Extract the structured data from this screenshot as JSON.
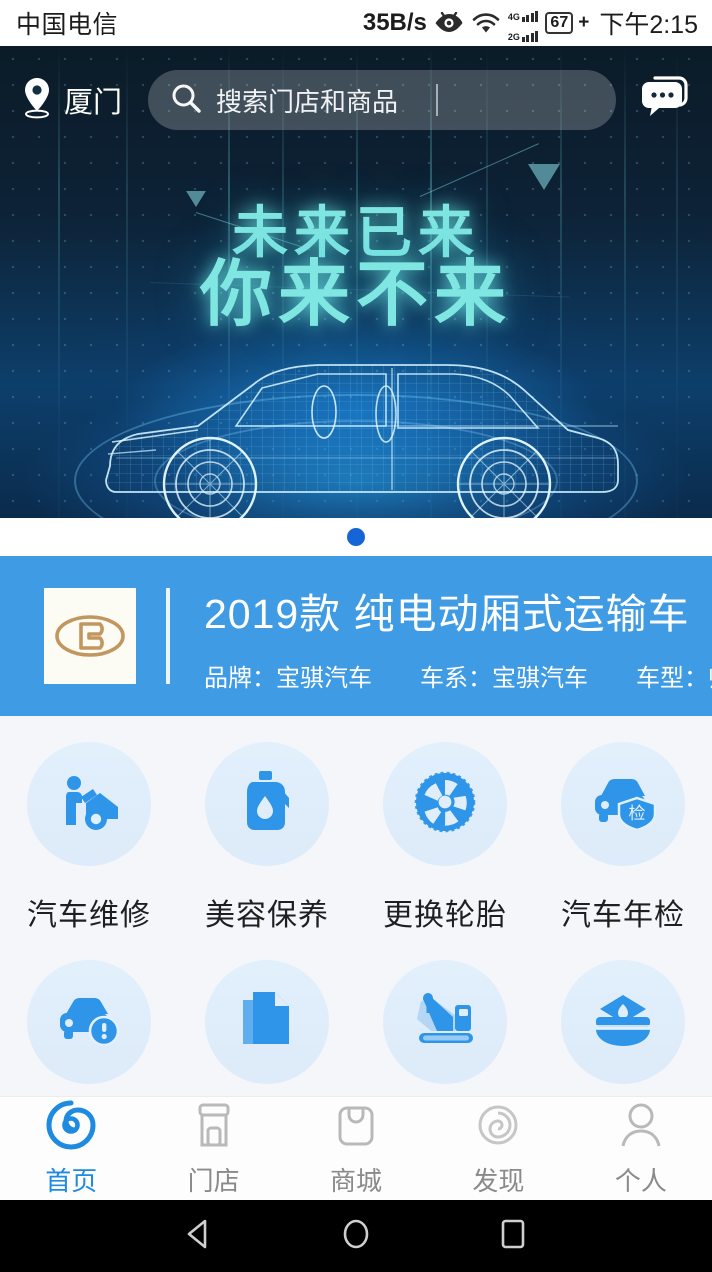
{
  "statusbar": {
    "carrier": "中国电信",
    "network_speed": "35B/s",
    "battery_percent": "67",
    "charging_glyph": "+",
    "time": "下午2:15",
    "signal_4g": "4G",
    "signal_2g": "2G",
    "icons": [
      "eye-icon",
      "wifi-icon",
      "signal-icon",
      "battery-icon"
    ]
  },
  "header": {
    "location": "厦门",
    "location_icon": "map-pin-icon",
    "search_placeholder": "搜索门店和商品",
    "search_value": "",
    "search_icon": "search-icon",
    "chat_icon": "chat-bubble-icon"
  },
  "hero": {
    "line1": "未来已来",
    "line2": "你来不来",
    "accent_color": "#7FE6E2",
    "background_color": "#0D2236",
    "pager_active_index": 0,
    "pager_count": 1,
    "pager_color": "#1565D8"
  },
  "car_card": {
    "background_color": "#3F9BE4",
    "logo_alt": "baoqi-logo",
    "title": "2019款 纯电动厢式运输车",
    "meta": [
      {
        "label": "品牌：",
        "value": "宝骐汽车"
      },
      {
        "label": "车系：",
        "value": "宝骐汽车"
      },
      {
        "label": "车型：",
        "value": "帅骐"
      }
    ]
  },
  "services": {
    "icon_color": "#2E95E8",
    "circle_color": "#E2F0FC",
    "row1": [
      {
        "label": "汽车维修",
        "icon": "car-repair-icon"
      },
      {
        "label": "美容保养",
        "icon": "oil-bottle-icon"
      },
      {
        "label": "更换轮胎",
        "icon": "tire-icon"
      },
      {
        "label": "汽车年检",
        "icon": "car-inspection-icon"
      }
    ],
    "row2": [
      {
        "label": "",
        "icon": "car-warning-icon"
      },
      {
        "label": "",
        "icon": "document-icon"
      },
      {
        "label": "",
        "icon": "crane-icon"
      },
      {
        "label": "",
        "icon": "police-cap-icon"
      }
    ]
  },
  "tabbar": {
    "active_color": "#1E8BE0",
    "inactive_color": "#8A8A8A",
    "items": [
      {
        "label": "首页",
        "icon": "home-swirl-icon",
        "active": true
      },
      {
        "label": "门店",
        "icon": "store-icon",
        "active": false
      },
      {
        "label": "商城",
        "icon": "shopping-bag-icon",
        "active": false
      },
      {
        "label": "发现",
        "icon": "discover-icon",
        "active": false
      },
      {
        "label": "个人",
        "icon": "person-icon",
        "active": false
      }
    ]
  },
  "navbar": {
    "items": [
      {
        "icon": "back-triangle-icon"
      },
      {
        "icon": "home-circle-icon"
      },
      {
        "icon": "recents-square-icon"
      }
    ]
  }
}
